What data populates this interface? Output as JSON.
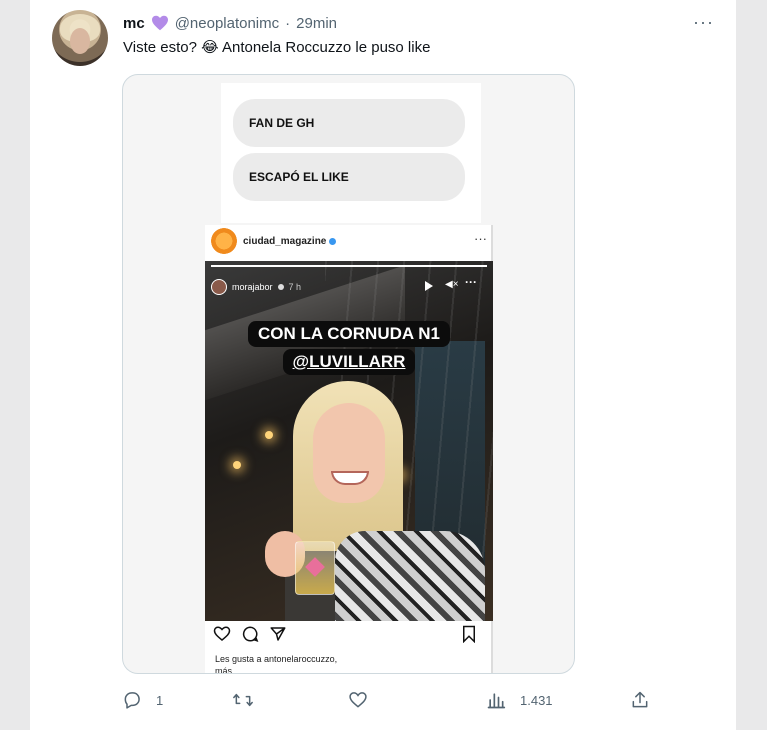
{
  "tweet": {
    "author_name": "mc",
    "handle": "@neoplatonimc",
    "separator": "·",
    "time": "29min",
    "text": "Viste esto? 😂 Antonela Roccuzzo le puso like",
    "more_icon": "more-horizontal-icon"
  },
  "media": {
    "options": [
      "FAN DE GH",
      "ESCAPÓ EL LIKE"
    ],
    "instagram": {
      "account": "ciudad_magazine",
      "story": {
        "user": "morajabor",
        "time": "7 h",
        "caption_line1": "CON LA CORNUDA N1",
        "caption_line2": "@LUVILLARR",
        "progress": 1.0
      },
      "likes_text_line1": "Les gusta a antonelaroccuzzo,",
      "likes_text_line2": "más"
    }
  },
  "actions": {
    "replies": "1",
    "retweets": "",
    "likes": "",
    "views": "1.431"
  },
  "colors": {
    "accent_heart": "#b38be8",
    "text_primary": "#0f1419",
    "text_secondary": "#536471"
  }
}
